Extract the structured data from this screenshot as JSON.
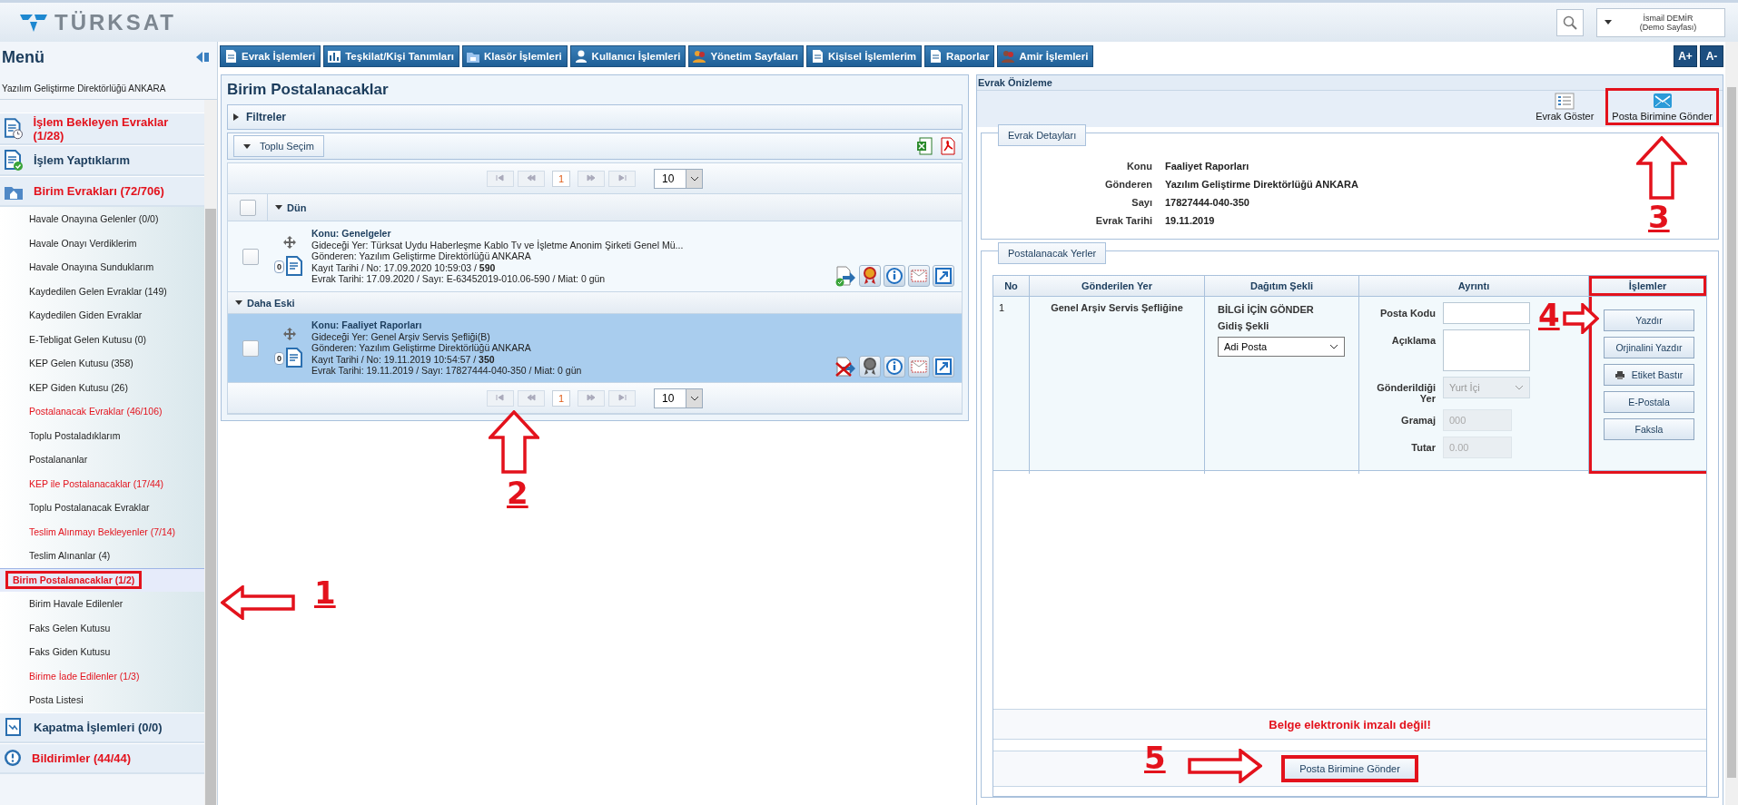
{
  "header": {
    "logo": "TÜRKSAT",
    "user_name": "İsmail DEMİR",
    "user_role": "(Demo Sayfası)"
  },
  "sidebar": {
    "title": "Menü",
    "organization": "Yazılım Geliştirme Direktörlüğü ANKARA",
    "items": [
      {
        "kind": "section",
        "label": "İşlem Bekleyen Evraklar (1/28)",
        "attention": true,
        "selected": false,
        "highlighted": false
      },
      {
        "kind": "section",
        "label": "İşlem Yaptıklarım",
        "attention": false,
        "selected": false,
        "highlighted": false
      },
      {
        "kind": "section",
        "label": "Birim Evrakları (72/706)",
        "attention": true,
        "selected": false,
        "highlighted": false,
        "children": [
          {
            "kind": "item",
            "label": "Havale Onayına Gelenler (0/0)",
            "attention": false,
            "selected": false,
            "highlighted": false
          },
          {
            "kind": "item",
            "label": "Havale Onayı Verdiklerim",
            "attention": false,
            "selected": false,
            "highlighted": false
          },
          {
            "kind": "item",
            "label": "Havale Onayına Sunduklarım",
            "attention": false,
            "selected": false,
            "highlighted": false
          },
          {
            "kind": "item",
            "label": "Kaydedilen Gelen Evraklar (149)",
            "attention": false,
            "selected": false,
            "highlighted": false
          },
          {
            "kind": "item",
            "label": "Kaydedilen Giden Evraklar",
            "attention": false,
            "selected": false,
            "highlighted": false
          },
          {
            "kind": "item",
            "label": "E-Tebligat Gelen Kutusu (0)",
            "attention": false,
            "selected": false,
            "highlighted": false
          },
          {
            "kind": "item",
            "label": "KEP Gelen Kutusu (358)",
            "attention": false,
            "selected": false,
            "highlighted": false
          },
          {
            "kind": "item",
            "label": "KEP Giden Kutusu (26)",
            "attention": false,
            "selected": false,
            "highlighted": false
          },
          {
            "kind": "item",
            "label": "Postalanacak Evraklar (46/106)",
            "attention": true,
            "selected": false,
            "highlighted": false
          },
          {
            "kind": "item",
            "label": "Toplu Postaladıklarım",
            "attention": false,
            "selected": false,
            "highlighted": false
          },
          {
            "kind": "item",
            "label": "Postalananlar",
            "attention": false,
            "selected": false,
            "highlighted": false
          },
          {
            "kind": "item",
            "label": "KEP ile Postalanacaklar (17/44)",
            "attention": true,
            "selected": false,
            "highlighted": false
          },
          {
            "kind": "item",
            "label": "Toplu Postalanacak Evraklar",
            "attention": false,
            "selected": false,
            "highlighted": false
          },
          {
            "kind": "item",
            "label": "Teslim Alınmayı Bekleyenler (7/14)",
            "attention": true,
            "selected": false,
            "highlighted": false
          },
          {
            "kind": "item",
            "label": "Teslim Alınanlar (4)",
            "attention": false,
            "selected": false,
            "highlighted": false
          },
          {
            "kind": "item",
            "label": "Birim Postalanacaklar (1/2)",
            "attention": true,
            "selected": true,
            "highlighted": true
          },
          {
            "kind": "item",
            "label": "Birim Havale Edilenler",
            "attention": false,
            "selected": false,
            "highlighted": false
          },
          {
            "kind": "item",
            "label": "Faks Gelen Kutusu",
            "attention": false,
            "selected": false,
            "highlighted": false
          },
          {
            "kind": "item",
            "label": "Faks Giden Kutusu",
            "attention": false,
            "selected": false,
            "highlighted": false
          },
          {
            "kind": "item",
            "label": "Birime İade Edilenler (1/3)",
            "attention": true,
            "selected": false,
            "highlighted": false
          },
          {
            "kind": "item",
            "label": "Posta Listesi",
            "attention": false,
            "selected": false,
            "highlighted": false
          }
        ]
      },
      {
        "kind": "section",
        "label": "Kapatma İşlemleri (0/0)",
        "attention": false,
        "selected": false,
        "highlighted": false
      },
      {
        "kind": "section",
        "label": "Bildirimler (44/44)",
        "attention": true,
        "selected": false,
        "highlighted": false
      }
    ]
  },
  "menu_tabs": [
    "Evrak İşlemleri",
    "Teşkilat/Kişi Tanımları",
    "Klasör İşlemleri",
    "Kullanıcı İşlemleri",
    "Yönetim Sayfaları",
    "Kişisel İşlemlerim",
    "Raporlar",
    "Amir İşlemleri"
  ],
  "font_buttons": [
    "A+",
    "A-"
  ],
  "list": {
    "title": "Birim Postalanacaklar",
    "filters": "Filtreler",
    "bulk_select": "Toplu Seçim",
    "pagers": [
      {
        "page": "1",
        "page_size": "10"
      },
      {
        "page": "1",
        "page_size": "10"
      }
    ],
    "groups": [
      {
        "label": "Dün",
        "select_all": {
          "checked": false
        },
        "records": [
          {
            "subject": "Konu: Genelgeler",
            "destination": "Gideceği Yer: Türksat Uydu Haberleşme Kablo Tv ve İşletme Anonim Şirketi Genel Mü...",
            "sender": "Gönderen: Yazılım Geliştirme Direktörlüğü ANKARA",
            "registry": "Kayıt Tarihi / No: 17.09.2020 10:59:03 / **590**",
            "document": "Evrak Tarihi: 17.09.2020 / Sayı: E-63452019-010.06-590 / Miat: 0 gün",
            "count": "0",
            "checked": false,
            "selected": false,
            "ready": true
          }
        ]
      },
      {
        "label": "Daha Eski",
        "records": [
          {
            "subject": "Konu: Faaliyet Raporları",
            "destination": "Gideceği Yer: Genel Arşiv Servis Şefliği(B)",
            "sender": "Gönderen: Yazılım Geliştirme Direktörlüğü ANKARA",
            "registry": "Kayıt Tarihi / No: 19.11.2019 10:54:57 / **350**",
            "document": "Evrak Tarihi: 19.11.2019 / Sayı: 17827444-040-350 / Miat: 0 gün",
            "count": "0",
            "checked": false,
            "selected": true,
            "ready": false
          }
        ]
      }
    ]
  },
  "preview": {
    "title": "Evrak Önizleme",
    "toolbar": [
      {
        "label": "Evrak Göster",
        "highlighted": false
      },
      {
        "label": "Posta Birimine Gönder",
        "highlighted": true
      }
    ],
    "details": {
      "legend": "Evrak Detayları",
      "fields": [
        {
          "label": "Konu",
          "value": "Faaliyet Raporları"
        },
        {
          "label": "Gönderen",
          "value": "Yazılım Geliştirme Direktörlüğü ANKARA"
        },
        {
          "label": "Sayı",
          "value": "17827444-040-350"
        },
        {
          "label": "Evrak Tarihi",
          "value": "19.11.2019"
        }
      ]
    },
    "places": {
      "legend": "Postalanacak Yerler",
      "columns": [
        "No",
        "Gönderilen Yer",
        "Dağıtım Şekli",
        "Ayrıntı",
        "İşlemler"
      ],
      "rows": [
        {
          "no": "1",
          "place": "Genel Arşiv Servis Şefliğine",
          "distribution": "BİLGİ İÇİN GÖNDER",
          "route_label": "Gidiş Şekli",
          "route": "Adi Posta",
          "fields": [
            {
              "kind": "input",
              "label": "Posta Kodu",
              "disabled": false
            },
            {
              "kind": "textarea",
              "label": "Açıklama",
              "disabled": false
            },
            {
              "kind": "select",
              "label": "Gönderildiği Yer",
              "value": "Yurt İçi",
              "disabled": true
            },
            {
              "kind": "input",
              "label": "Gramaj",
              "placeholder": "000",
              "disabled": true
            },
            {
              "kind": "input",
              "label": "Tutar",
              "placeholder": "0.00",
              "disabled": true
            }
          ]
        }
      ],
      "actions": [
        {
          "kind": "plain",
          "label": "Yazdır"
        },
        {
          "kind": "plain",
          "label": "Orjinalini Yazdır"
        },
        {
          "kind": "print",
          "label": "Etiket Bastır"
        },
        {
          "kind": "plain",
          "label": "E-Postala"
        },
        {
          "kind": "plain",
          "label": "Faksla"
        }
      ],
      "actions_highlighted": true,
      "message": "Belge elektronik imzalı değil!",
      "submit": {
        "label": "Posta Birimine Gönder",
        "highlighted": true
      }
    }
  },
  "annotations": [
    {
      "number": "1",
      "kind": "left"
    },
    {
      "number": "2",
      "kind": "up"
    },
    {
      "number": "3",
      "kind": "up"
    },
    {
      "number": "4",
      "kind": "right"
    },
    {
      "number": "5",
      "kind": "right"
    }
  ]
}
